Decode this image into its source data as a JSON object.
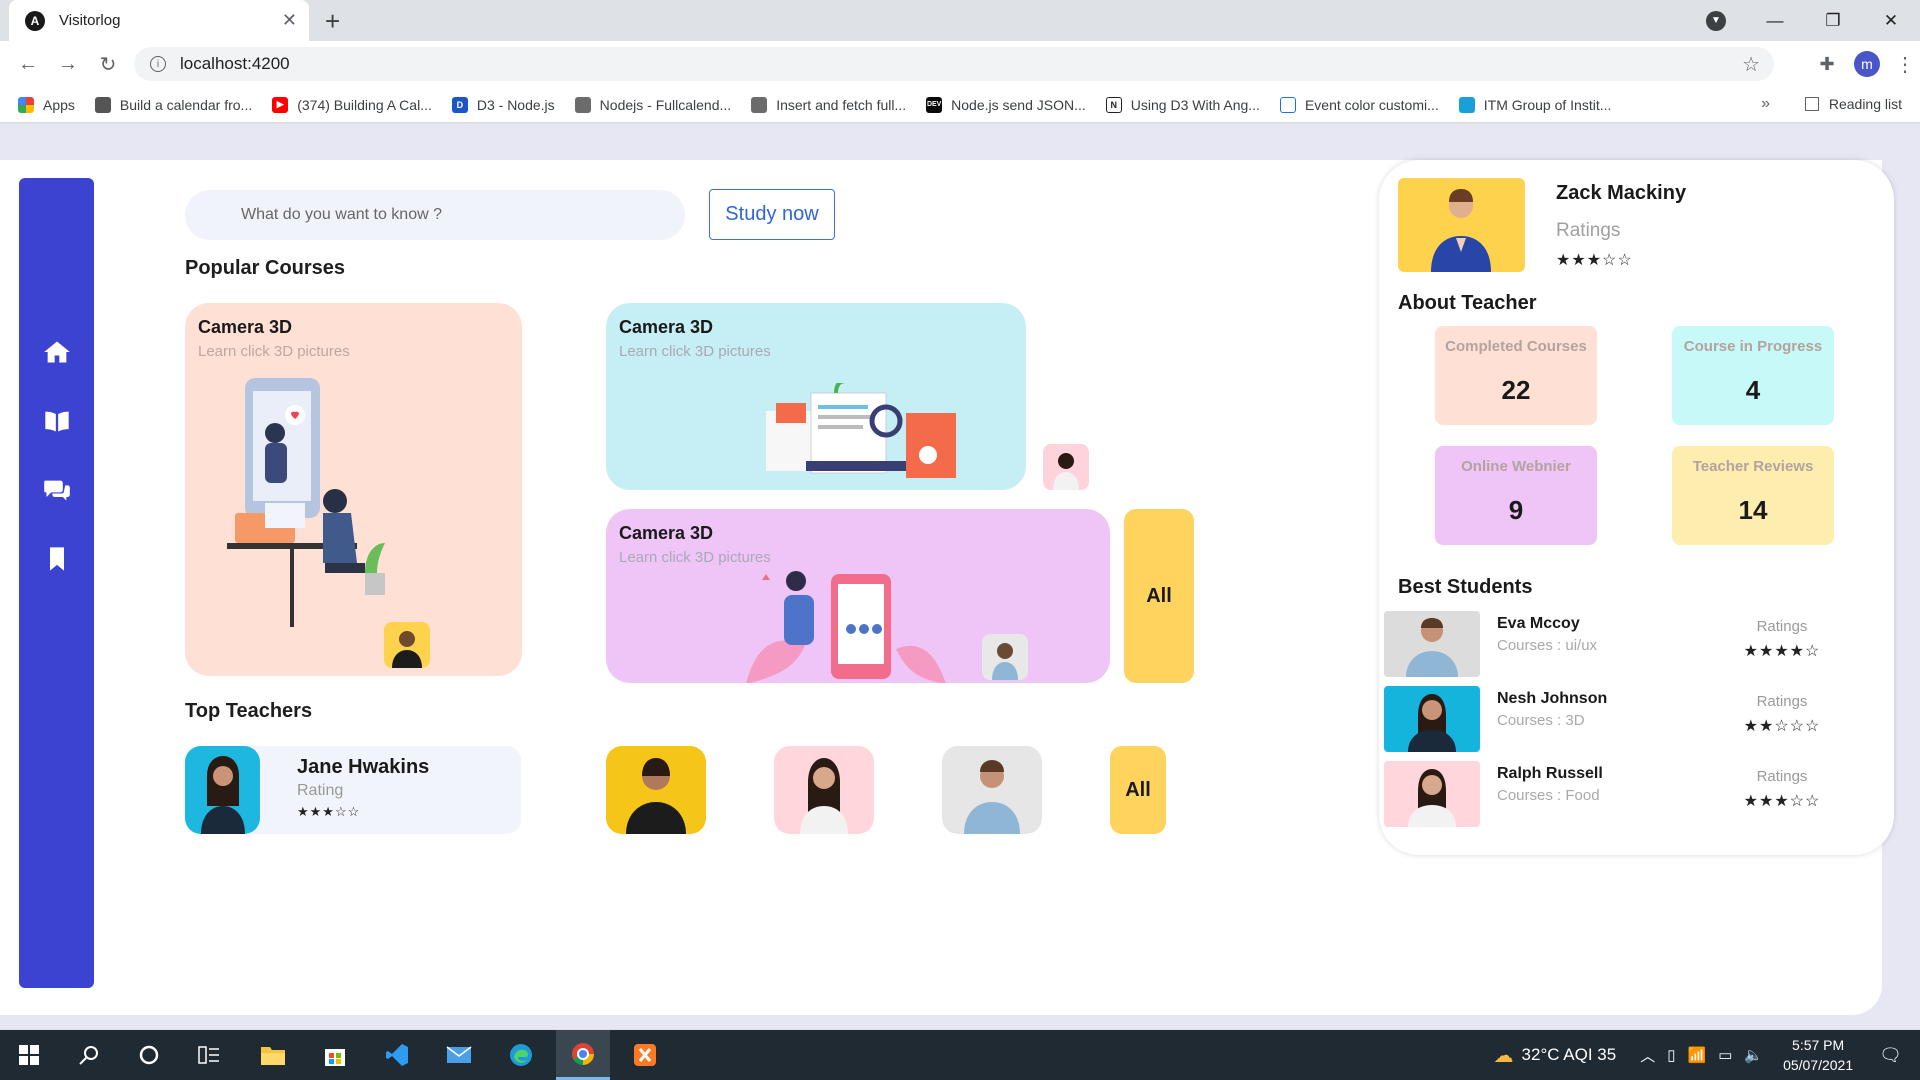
{
  "browser": {
    "tab_title": "Visitorlog",
    "url": "localhost:4200",
    "profile_initial": "m",
    "bookmarks": [
      {
        "label": "Apps",
        "color": "#ea4335"
      },
      {
        "label": "Build a calendar fro...",
        "color": "#555555"
      },
      {
        "label": "(374) Building A Cal...",
        "color": "#ff0000"
      },
      {
        "label": "D3 - Node.js",
        "color": "#1a56c7"
      },
      {
        "label": "Nodejs - Fullcalend...",
        "color": "#6b6b6b"
      },
      {
        "label": "Insert and fetch full...",
        "color": "#6b6b6b"
      },
      {
        "label": "Node.js send JSON...",
        "color": "#0a0a0a"
      },
      {
        "label": "Using D3 With Ang...",
        "color": "#222222"
      },
      {
        "label": "Event color customi...",
        "color": "#1a73e8"
      },
      {
        "label": "ITM Group of Instit...",
        "color": "#1aa0d8"
      }
    ],
    "bookmarks_more": "»",
    "reading_list": "Reading list"
  },
  "app": {
    "search": {
      "placeholder": "What do you want to know ?"
    },
    "study_button": "Study now",
    "popular_courses_title": "Popular Courses",
    "courses": [
      {
        "title": "Camera 3D",
        "subtitle": "Learn click 3D pictures"
      },
      {
        "title": "Camera 3D",
        "subtitle": "Learn click 3D pictures"
      },
      {
        "title": "Camera 3D",
        "subtitle": "Learn click 3D pictures"
      }
    ],
    "courses_all": "All",
    "top_teachers_title": "Top Teachers",
    "featured_teacher": {
      "name": "Jane Hwakins",
      "rating_label": "Rating",
      "stars": "★★★☆☆"
    },
    "teachers_all": "All",
    "sidebar_icons": [
      "home-icon",
      "book-icon",
      "chat-icon",
      "bookmark-icon"
    ]
  },
  "panel": {
    "teacher_name": "Zack Mackiny",
    "ratings_label": "Ratings",
    "stars": "★★★☆☆",
    "about_title": "About Teacher",
    "stats": [
      {
        "label": "Completed Courses",
        "value": "22",
        "color": "#ffe0d5"
      },
      {
        "label": "Course in Progress",
        "value": "4",
        "color": "#c6f9f7"
      },
      {
        "label": "Online Webnier",
        "value": "9",
        "color": "#efc5f7"
      },
      {
        "label": "Teacher Reviews",
        "value": "14",
        "color": "#fdeeb0"
      }
    ],
    "best_students_title": "Best Students",
    "students": [
      {
        "name": "Eva Mccoy",
        "course": "Courses : ui/ux",
        "ratings_label": "Ratings",
        "stars": "★★★★☆"
      },
      {
        "name": "Nesh Johnson",
        "course": "Courses : 3D",
        "ratings_label": "Ratings",
        "stars": "★★☆☆☆"
      },
      {
        "name": "Ralph Russell",
        "course": "Courses : Food",
        "ratings_label": "Ratings",
        "stars": "★★★☆☆"
      }
    ]
  },
  "taskbar": {
    "weather": "32°C  AQI 35",
    "time": "5:57 PM",
    "date": "05/07/2021"
  }
}
